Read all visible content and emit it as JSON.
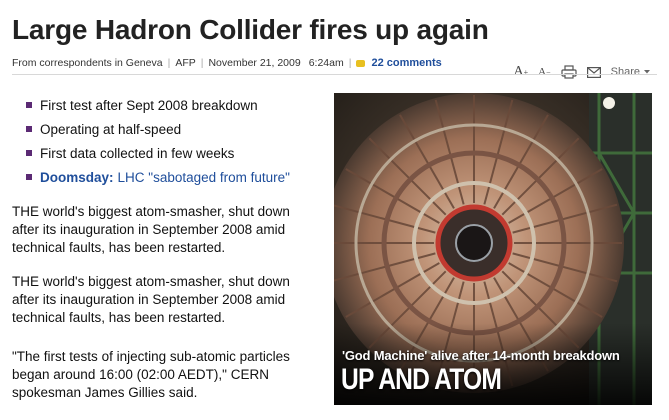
{
  "article": {
    "headline": "Large Hadron Collider fires up again",
    "byline": {
      "author": "From correspondents in Geneva",
      "source": "AFP",
      "date": "November 21, 2009",
      "time": "6:24am",
      "comments": "22 comments"
    },
    "tools": {
      "font_up": "A",
      "font_up_sign": "+",
      "font_down": "A",
      "font_down_sign": "−",
      "share": "Share"
    },
    "bullets": [
      "First test after Sept 2008 breakdown",
      "Operating at half-speed",
      "First data collected in few weeks"
    ],
    "related": {
      "label": "Doomsday:",
      "link": "LHC \"sabotaged from future\""
    },
    "paragraphs": [
      "THE world's biggest atom-smasher, shut down after its inauguration in September 2008 amid technical faults, has been restarted.",
      "THE world's biggest atom-smasher, shut down after its inauguration in September 2008 amid technical faults, has been restarted.",
      "\"The first tests of injecting sub-atomic particles began around 16:00 (02:00 AEDT),\" CERN spokesman James Gillies said."
    ],
    "photo": {
      "caption_top": "'God Machine' alive after 14-month breakdown",
      "caption_main": "UP AND ATOM"
    }
  },
  "colors": {
    "link_blue": "#1f4e9b",
    "bullet_purple": "#5b2a74",
    "comment_yellow": "#e8c020"
  }
}
